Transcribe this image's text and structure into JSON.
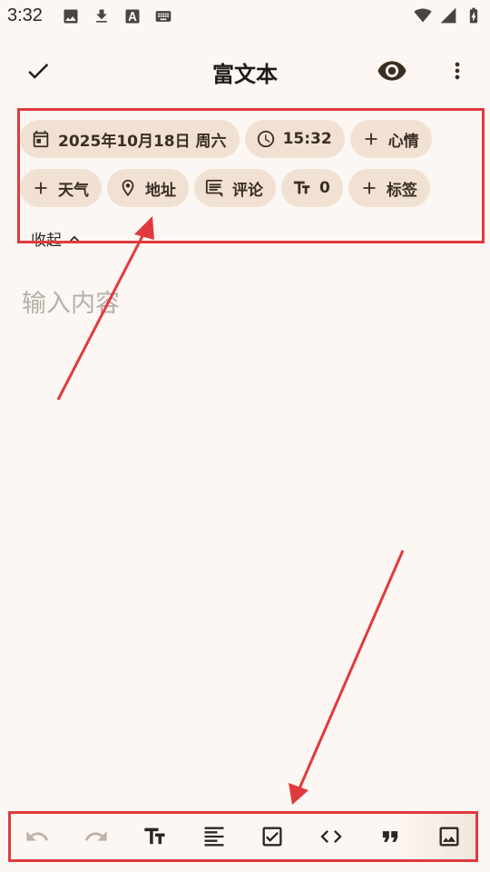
{
  "status_bar": {
    "time": "3:32",
    "left_icons": [
      "image-icon",
      "download-icon",
      "a-letter-icon",
      "keyboard-icon"
    ],
    "right_icons": [
      "wifi-icon",
      "signal-icon",
      "battery-charging-icon"
    ]
  },
  "app_bar": {
    "title": "富文本",
    "left_icon": "check-icon",
    "right_icons": [
      "eye-icon",
      "more-vert-icon"
    ]
  },
  "meta": {
    "date": "2025年10月18日 周六",
    "time": "15:32",
    "mood": "心情",
    "weather": "天气",
    "location": "地址",
    "comment": "评论",
    "word_count": "0",
    "tag": "标签",
    "collapse_label": "收起"
  },
  "editor": {
    "placeholder": "输入内容"
  },
  "toolbar": {
    "icons": [
      "undo-icon",
      "redo-icon",
      "text-size-icon",
      "align-left-icon",
      "checkbox-icon",
      "code-icon",
      "quote-icon",
      "image-icon"
    ]
  },
  "colors": {
    "background": "#fdf7f3",
    "chip_background": "#f0e1d2",
    "annotation": "#e03a3e",
    "text": "#1f1b16",
    "placeholder": "#b7b0aa"
  }
}
